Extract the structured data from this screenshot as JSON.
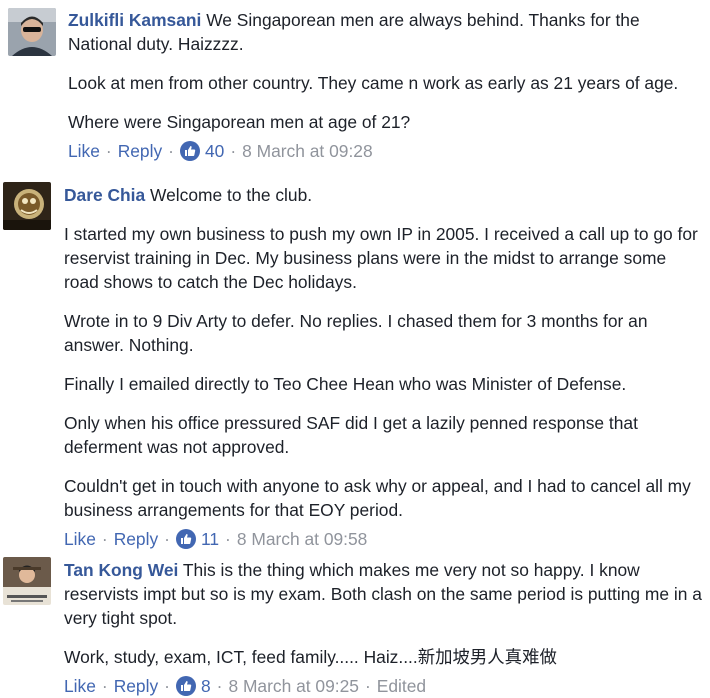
{
  "comments": [
    {
      "author": "Zulkifli Kamsani",
      "first": "We Singaporean men are always behind. Thanks for the National duty. Haizzzz.",
      "paragraphs": [
        "Look at men from other country. They came n work as early as 21 years of age.",
        "Where were Singaporean men at age of 21?"
      ],
      "like_label": "Like",
      "reply_label": "Reply",
      "reactions": "40",
      "timestamp": "8 March at 09:28",
      "avatar_icon": "user-avatar"
    },
    {
      "author": "Dare Chia",
      "first": "Welcome to the club.",
      "paragraphs": [
        "I started my own business to push my own IP in 2005. I received a call up to go for reservist training in Dec. My business plans were in the midst to arrange some road shows to catch the Dec holidays.",
        "Wrote in to 9 Div Arty to defer. No replies. I chased them for 3 months for an answer. Nothing.",
        "Finally I emailed directly to Teo Chee Hean who was Minister of Defense.",
        "Only when his office pressured SAF did I get a lazily penned response that deferment was not approved.",
        "Couldn't get in touch with anyone to ask why or appeal, and I had to cancel all my business arrangements for that EOY period."
      ],
      "like_label": "Like",
      "reply_label": "Reply",
      "reactions": "11",
      "timestamp": "8 March at 09:58",
      "avatar_icon": "user-avatar"
    },
    {
      "author": "Tan Kong Wei",
      "first": "This is the thing which makes me very not so happy. I know reservists impt but so is my exam. Both clash on the same period is putting me in a very tight spot.",
      "paragraphs": [
        "Work, study, exam, ICT, feed family..... Haiz....",
        "新加坡男人真难做"
      ],
      "like_label": "Like",
      "reply_label": "Reply",
      "reactions": "8",
      "timestamp": "8 March at 09:25",
      "edited": "Edited",
      "avatar_icon": "user-avatar"
    }
  ],
  "colors": {
    "name": "#365899",
    "link": "#4267b2",
    "meta": "#90949c",
    "text": "#1d2129"
  }
}
